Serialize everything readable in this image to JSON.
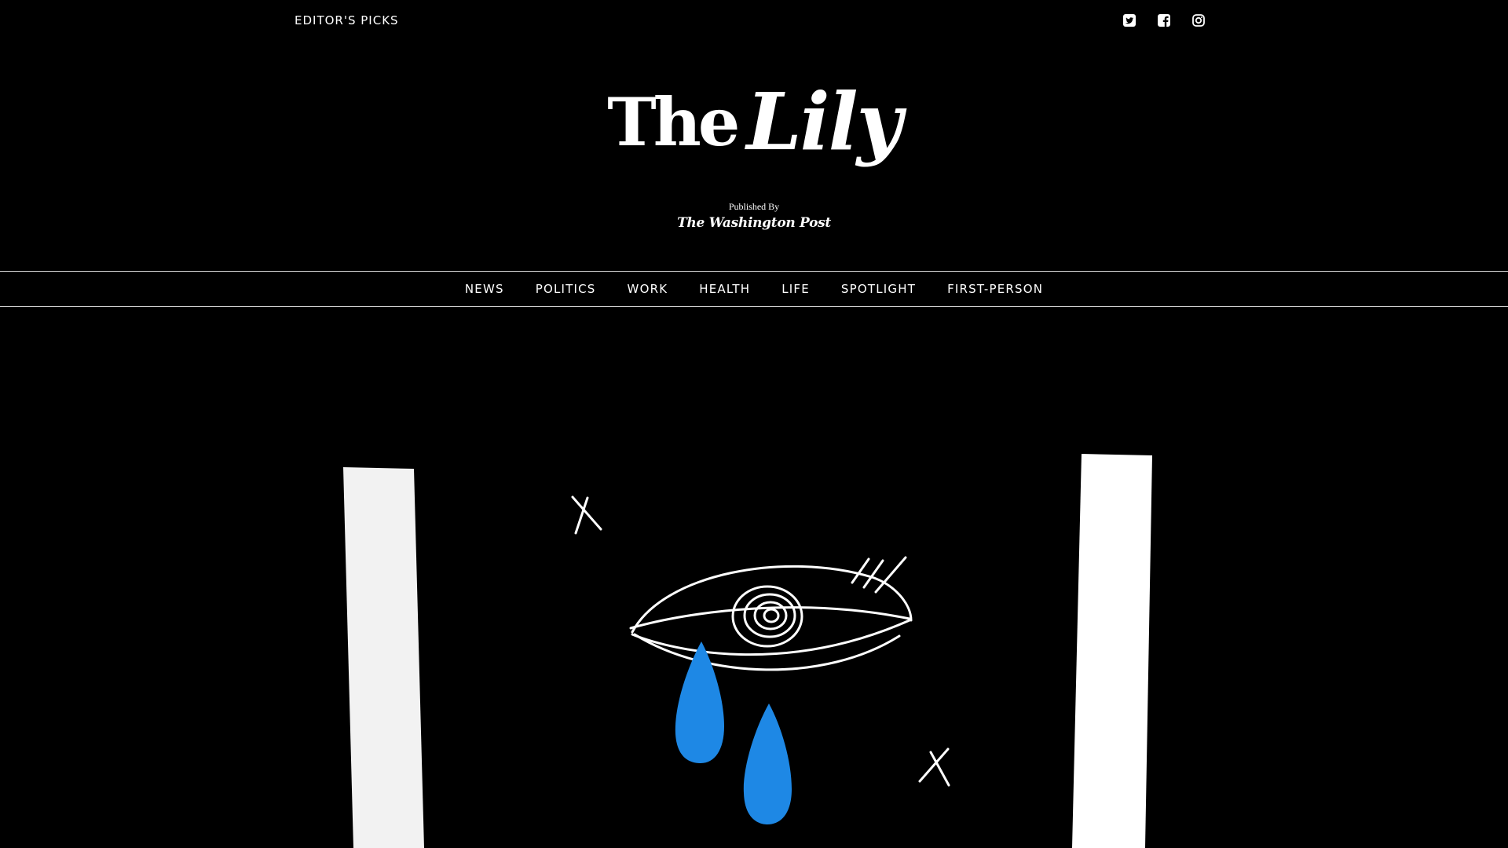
{
  "topbar": {
    "editors_picks_label": "EDITOR'S PICKS",
    "social": [
      {
        "name": "twitter",
        "icon": "twitter-icon"
      },
      {
        "name": "facebook",
        "icon": "facebook-icon"
      },
      {
        "name": "instagram",
        "icon": "instagram-icon"
      }
    ]
  },
  "masthead": {
    "logo_the": "The",
    "logo_lily": "Lily",
    "published_by": "Published By",
    "publisher": "The Washington Post"
  },
  "nav": {
    "items": [
      {
        "label": "NEWS"
      },
      {
        "label": "POLITICS"
      },
      {
        "label": "WORK"
      },
      {
        "label": "HEALTH"
      },
      {
        "label": "LIFE"
      },
      {
        "label": "SPOTLIGHT"
      },
      {
        "label": "FIRST-PERSON"
      }
    ]
  },
  "hero": {
    "illustration": "crying-eye-illustration",
    "tear_color": "#1e88e5",
    "line_color": "#ffffff"
  },
  "colors": {
    "background": "#000000",
    "text": "#ffffff",
    "divider": "#d9d9d9"
  }
}
